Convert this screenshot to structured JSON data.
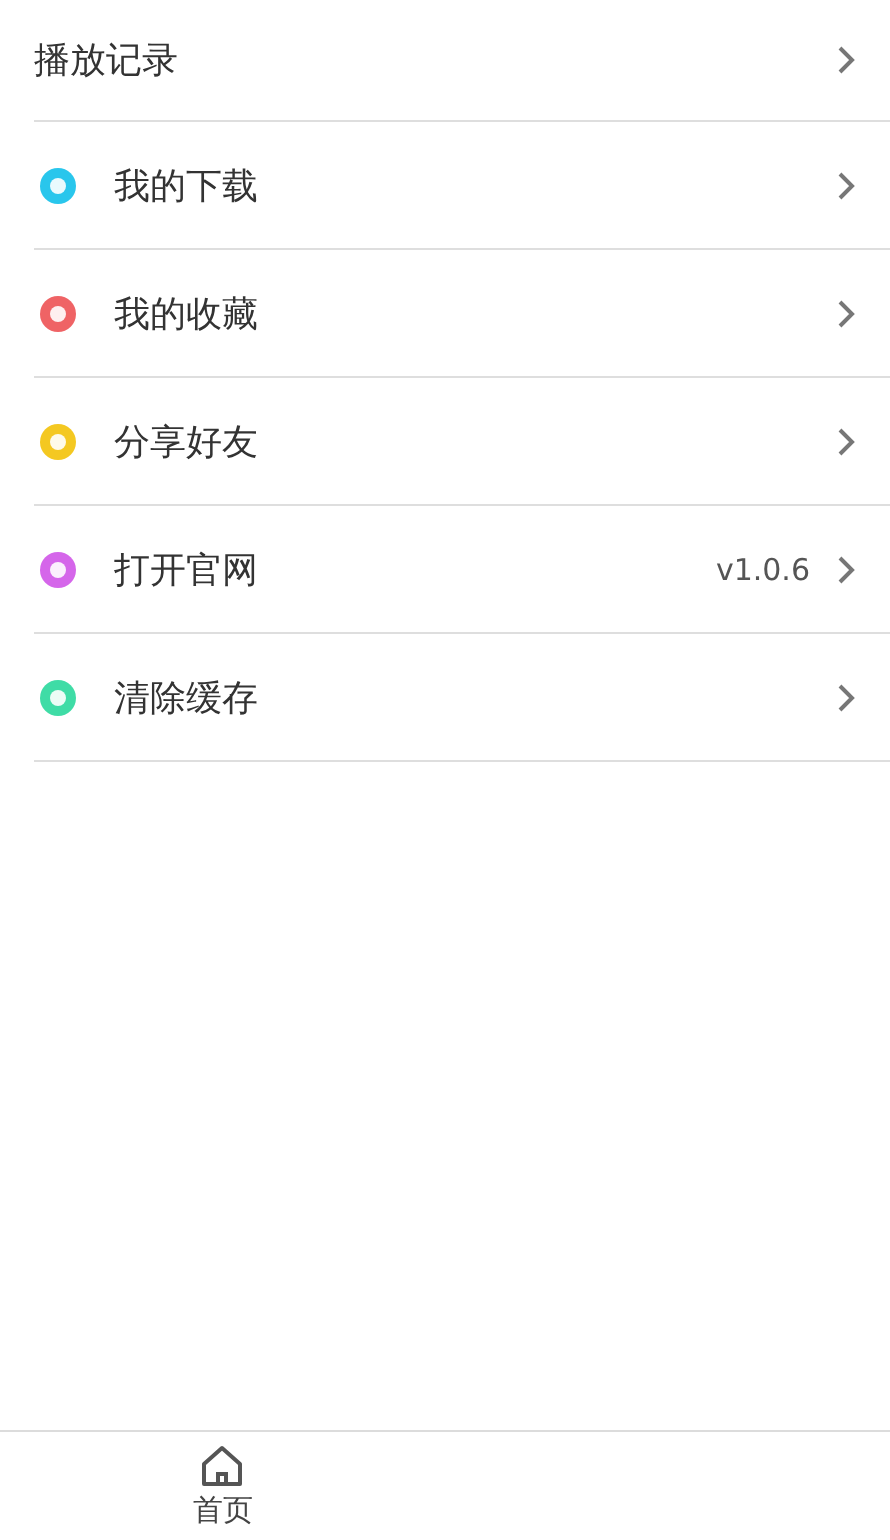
{
  "header_row": {
    "label": "播放记录"
  },
  "menu_items": [
    {
      "label": "我的下载",
      "color": "#29c6ec"
    },
    {
      "label": "我的收藏",
      "color": "#ef6365"
    },
    {
      "label": "分享好友",
      "color": "#f4c821"
    },
    {
      "label": "打开官网",
      "color": "#d566ea",
      "value": "v1.0.6"
    },
    {
      "label": "清除缓存",
      "color": "#3fdca6"
    }
  ],
  "tab_bar": [
    {
      "label": "首页",
      "selected": true
    }
  ]
}
